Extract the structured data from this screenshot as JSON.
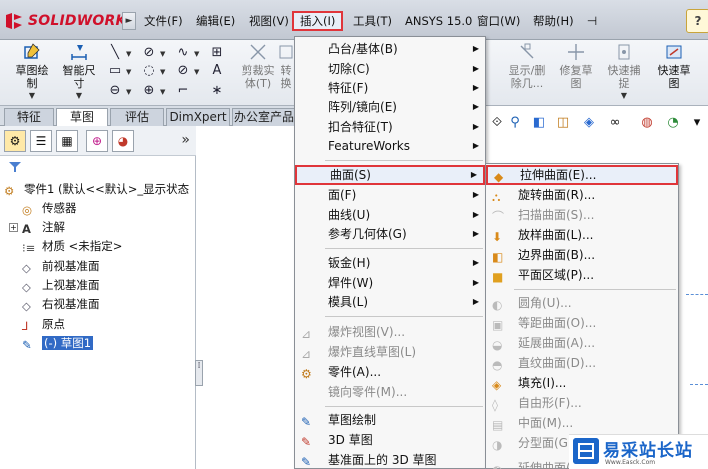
{
  "app": {
    "logo_text": "SOLIDWORKS",
    "logo_arrow": "►"
  },
  "menubar": {
    "items": [
      "文件(F)",
      "编辑(E)",
      "视图(V)",
      "插入(I)",
      "工具(T)",
      "ANSYS 15.0",
      "窗口(W)",
      "帮助(H)"
    ],
    "help_symbol": "?"
  },
  "commands": {
    "sketch_draw": "草图绘\n制",
    "smart_dim": "智能尺\n寸",
    "trim": "剪裁实\n体(T)",
    "convert": "转\n换",
    "show_delete": "显示/删\n除几...",
    "repair": "修复草\n图",
    "quick_snap": "快速捕\n捉",
    "quick_sketch": "快速草\n图"
  },
  "tabs": [
    "特征",
    "草图",
    "评估",
    "DimXpert",
    "办公室产品"
  ],
  "feature_tree": {
    "root": "零件1 (默认<<默认>_显示状态",
    "items": [
      "传感器",
      "注解",
      "材质 <未指定>",
      "前视基准面",
      "上视基准面",
      "右视基准面",
      "原点",
      "(-) 草图1"
    ]
  },
  "insert_menu": {
    "items": [
      {
        "label": "凸台/基体(B)",
        "sub": true,
        "dis": false
      },
      {
        "label": "切除(C)",
        "sub": true,
        "dis": false
      },
      {
        "label": "特征(F)",
        "sub": true,
        "dis": false
      },
      {
        "label": "阵列/镜向(E)",
        "sub": true,
        "dis": false
      },
      {
        "label": "扣合特征(T)",
        "sub": true,
        "dis": false
      },
      {
        "label": "FeatureWorks",
        "sub": true,
        "dis": false
      },
      {
        "label": "曲面(S)",
        "sub": true,
        "dis": false
      },
      {
        "label": "面(F)",
        "sub": true,
        "dis": false
      },
      {
        "label": "曲线(U)",
        "sub": true,
        "dis": false
      },
      {
        "label": "参考几何体(G)",
        "sub": true,
        "dis": false
      },
      {
        "label": "钣金(H)",
        "sub": true,
        "dis": false
      },
      {
        "label": "焊件(W)",
        "sub": true,
        "dis": false
      },
      {
        "label": "模具(L)",
        "sub": true,
        "dis": false
      },
      {
        "label": "爆炸视图(V)...",
        "sub": false,
        "dis": true
      },
      {
        "label": "爆炸直线草图(L)",
        "sub": false,
        "dis": true
      },
      {
        "label": "零件(A)...",
        "sub": false,
        "dis": false
      },
      {
        "label": "镜向零件(M)...",
        "sub": false,
        "dis": true
      },
      {
        "label": "草图绘制",
        "sub": false,
        "dis": false
      },
      {
        "label": "3D 草图",
        "sub": false,
        "dis": false
      },
      {
        "label": "基准面上的 3D 草图",
        "sub": false,
        "dis": false
      }
    ]
  },
  "surface_menu": {
    "items": [
      {
        "label": "拉伸曲面(E)...",
        "dis": false
      },
      {
        "label": "旋转曲面(R)...",
        "dis": false
      },
      {
        "label": "扫描曲面(S)...",
        "dis": true
      },
      {
        "label": "放样曲面(L)...",
        "dis": false
      },
      {
        "label": "边界曲面(B)...",
        "dis": false
      },
      {
        "label": "平面区域(P)...",
        "dis": false
      },
      {
        "label": "圆角(U)...",
        "dis": true
      },
      {
        "label": "等距曲面(O)...",
        "dis": true
      },
      {
        "label": "延展曲面(A)...",
        "dis": true
      },
      {
        "label": "直纹曲面(D)...",
        "dis": true
      },
      {
        "label": "填充(I)...",
        "dis": false
      },
      {
        "label": "自由形(F)...",
        "dis": true
      },
      {
        "label": "中面(M)...",
        "dis": true
      },
      {
        "label": "分型面(G)...",
        "dis": true
      },
      {
        "label": "延伸曲面(X)...",
        "dis": true
      }
    ]
  },
  "watermark": {
    "text": "易采站长站",
    "sub": "Www.Easck.Com"
  }
}
